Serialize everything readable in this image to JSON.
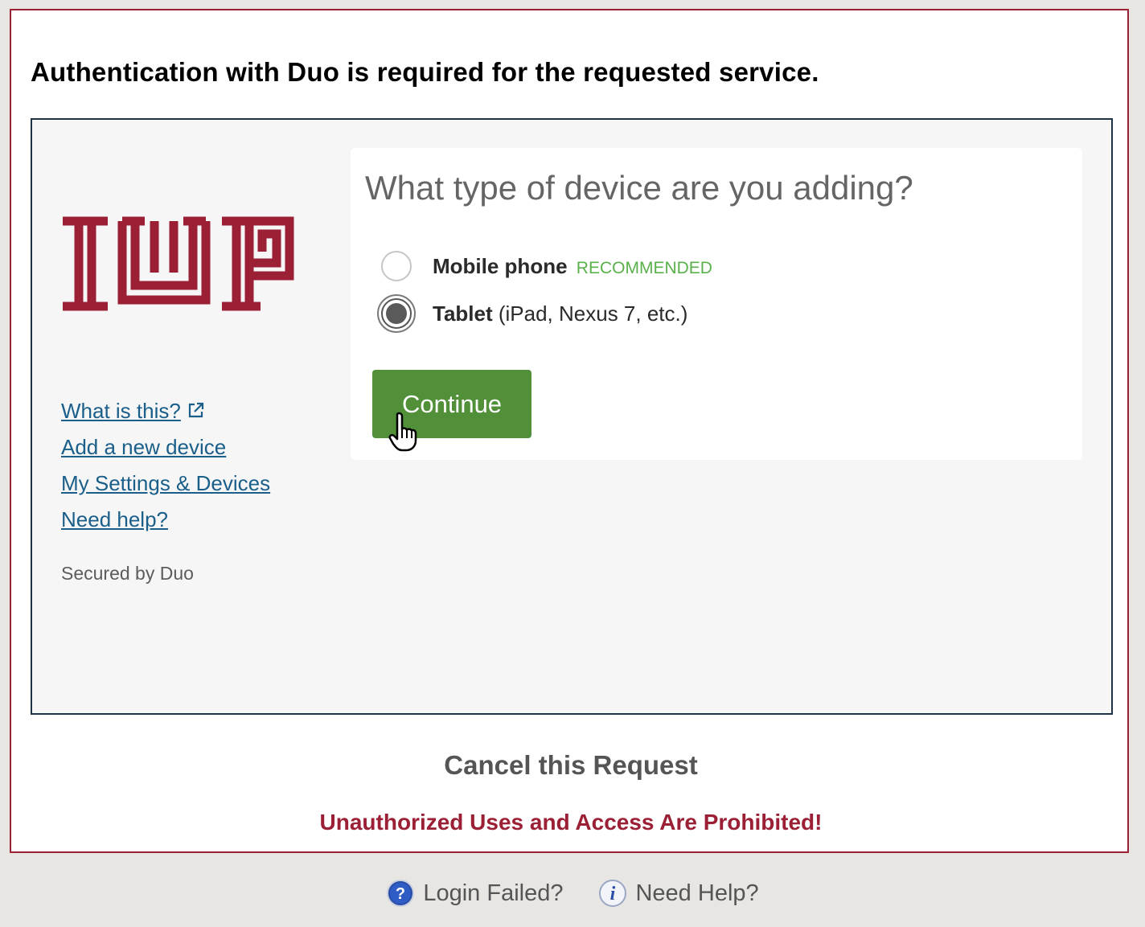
{
  "header": {
    "title": "Authentication with Duo is required for the requested service."
  },
  "duo": {
    "logo_text": "IUP",
    "links": [
      {
        "label": "What is this?"
      },
      {
        "label": "Add a new device"
      },
      {
        "label": "My Settings & Devices"
      },
      {
        "label": "Need help?"
      }
    ],
    "secured_by": "Secured by Duo",
    "prompt": {
      "title": "What type of device are you adding?",
      "options": [
        {
          "label": "Mobile phone",
          "badge": "RECOMMENDED",
          "detail": "",
          "selected": false
        },
        {
          "label": "Tablet",
          "badge": "",
          "detail": " (iPad, Nexus 7, etc.)",
          "selected": true
        }
      ],
      "continue_label": "Continue"
    }
  },
  "cancel_label": "Cancel this Request",
  "warning": "Unauthorized Uses and Access Are Prohibited!",
  "footer": {
    "login_failed": "Login Failed?",
    "need_help": "Need Help?"
  },
  "colors": {
    "brand": "#9c2035",
    "continue_button": "#519039",
    "recommended": "#5ab14b",
    "link": "#1a5e8a"
  },
  "icons": {
    "external_link": "external-link-icon",
    "help": "question-mark-icon",
    "info": "info-icon",
    "cursor": "hand-pointer-icon"
  }
}
